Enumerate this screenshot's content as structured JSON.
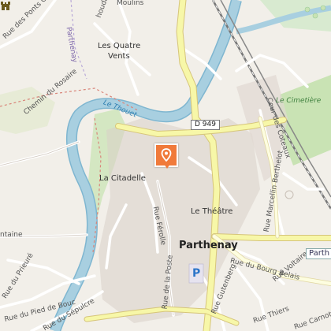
{
  "map": {
    "town": "Parthenay",
    "labels": {
      "top_road": "Rue des Ponts Coutr",
      "top_moulins": "Moulins",
      "top_houdan": "houdan",
      "place_quatre": "Les Quatre",
      "place_vents": "Vents",
      "rosaire": "Chemin du Rosaire",
      "river": "Le Thouet",
      "citadelle": "La Citadelle",
      "highway": "D 949",
      "cimetiere": "Le Cimetière",
      "coteaux": "Cour des Coteaux",
      "marcellin": "Rue Marcellin Berthelot",
      "theatre": "Le Théâtre",
      "ferolle": "Rue Férolle",
      "bourg_belais": "Rue du Bourg Belais",
      "poste": "Rue de la Poste",
      "voltaire": "Rue Voltaire",
      "gutenberg": "Rue Gutenberg",
      "thiers": "Rue Thiers",
      "carnot": "Rue Carnot",
      "pied_bouc": "Rue du Pied de Bouc",
      "sepulcre": "Rue du Sépulcre",
      "prieure": "Rue du Prieuré",
      "fontaine": "ntaine",
      "parthenay_small": "Parthenay",
      "parthenay_cut": "Parth",
      "parking": "P"
    },
    "marker_name": "map-pin-icon",
    "castle_name": "castle-icon",
    "colors": {
      "water": "#a8cfe0",
      "water_edge": "#7fb6d0",
      "green": "#c9e3b4",
      "road_major": "#f7f7a8",
      "road_edge": "#d6c57a",
      "rail": "#777777",
      "marker": "#f07a3a",
      "building": "#d9d0c9"
    }
  }
}
